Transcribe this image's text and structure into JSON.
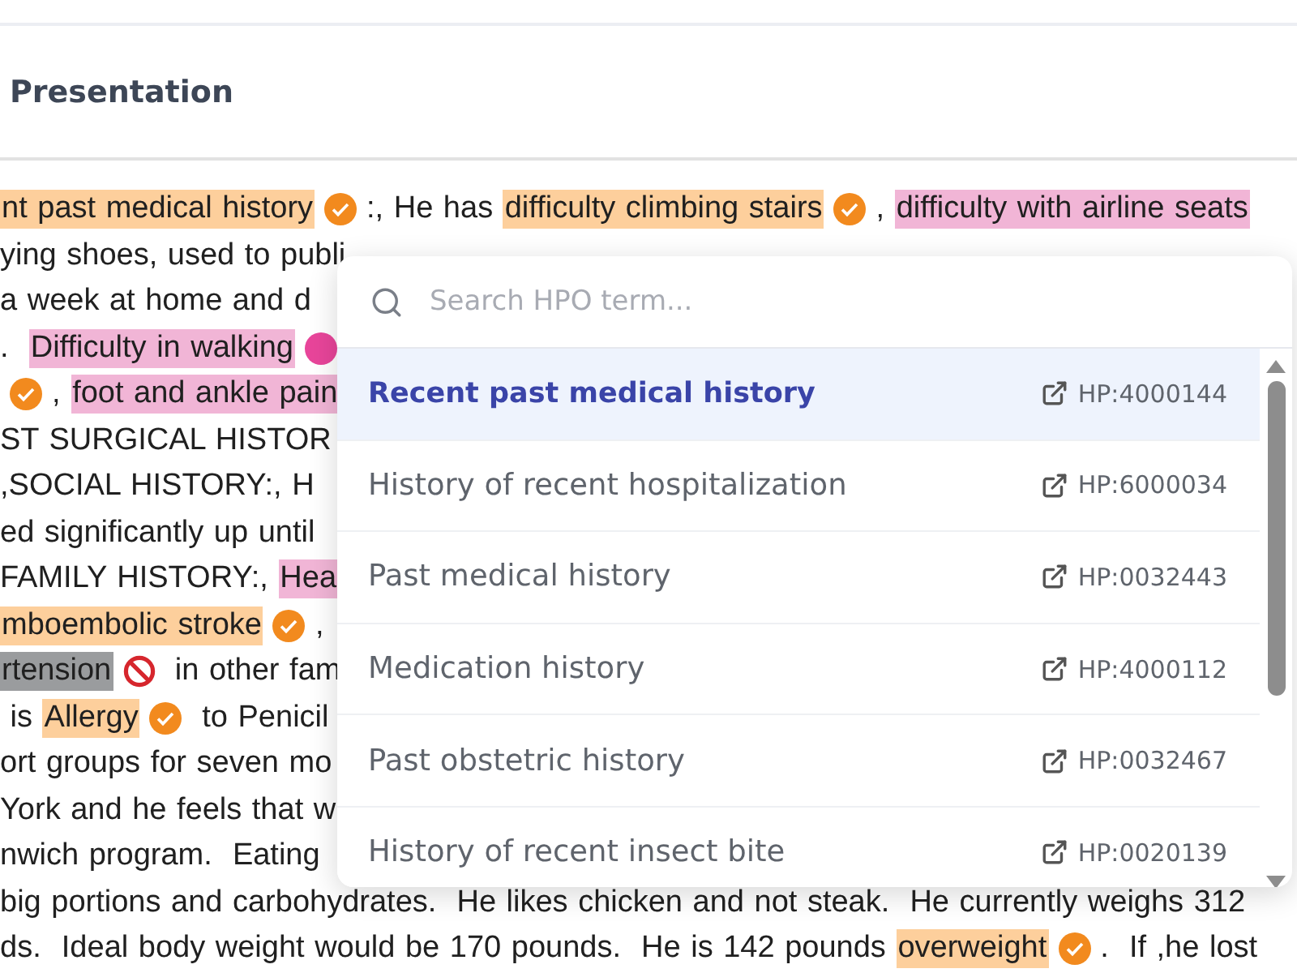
{
  "section": {
    "title": "Presentation"
  },
  "lines": [
    [
      {
        "kind": "term",
        "text": "nt past medical history",
        "color": "#fdcf9c"
      },
      {
        "kind": "check"
      },
      {
        "kind": "text",
        "text": ":, He has "
      },
      {
        "kind": "term",
        "text": "difficulty climbing stairs",
        "color": "#fdcf9c"
      },
      {
        "kind": "check"
      },
      {
        "kind": "text",
        "text": ", "
      },
      {
        "kind": "term",
        "text": "difficulty with airline seats",
        "color": "#f1b5d6"
      }
    ],
    [
      {
        "kind": "text",
        "text": "ying shoes, used to publi"
      }
    ],
    [
      {
        "kind": "text",
        "text": "a week at home and d"
      }
    ],
    [
      {
        "kind": "text",
        "text": ".  "
      },
      {
        "kind": "term",
        "text": "Difficulty in walking",
        "color": "#f1b5d6"
      },
      {
        "kind": "dot",
        "color": "#e8459a"
      }
    ],
    [
      {
        "kind": "check"
      },
      {
        "kind": "text",
        "text": ", "
      },
      {
        "kind": "term",
        "text": "foot and ankle pain",
        "color": "#f1b5d6"
      }
    ],
    [
      {
        "kind": "text",
        "text": "ST SURGICAL HISTOR"
      }
    ],
    [
      {
        "kind": "text",
        "text": ",SOCIAL HISTORY:, H"
      }
    ],
    [
      {
        "kind": "text",
        "text": "ed significantly up until"
      }
    ],
    [
      {
        "kind": "text",
        "text": "FAMILY HISTORY:, "
      },
      {
        "kind": "term",
        "text": "Hea",
        "color": "#f1b5d6"
      }
    ],
    [
      {
        "kind": "term",
        "text": "mboembolic stroke",
        "color": "#fdcf9c"
      },
      {
        "kind": "check"
      },
      {
        "kind": "text",
        "text": ","
      }
    ],
    [
      {
        "kind": "term",
        "text": "rtension",
        "color": "#9a9c9e"
      },
      {
        "kind": "ban"
      },
      {
        "kind": "text",
        "text": " in other fam"
      }
    ],
    [
      {
        "kind": "text",
        "text": " is "
      },
      {
        "kind": "term",
        "text": "Allergy",
        "color": "#fdcf9c"
      },
      {
        "kind": "check"
      },
      {
        "kind": "text",
        "text": " to Penicil"
      }
    ],
    [
      {
        "kind": "text",
        "text": "ort groups for seven mo"
      }
    ],
    [
      {
        "kind": "text",
        "text": "York and he feels that w"
      }
    ],
    [
      {
        "kind": "text",
        "text": "nwich program.  Eating"
      }
    ],
    [
      {
        "kind": "text",
        "text": "big portions and carbohydrates.  He likes chicken and not steak.  He currently weighs 312"
      }
    ],
    [
      {
        "kind": "text",
        "text": "ds.  Ideal body weight would be 170 pounds.  He is 142 pounds "
      },
      {
        "kind": "term",
        "text": "overweight",
        "color": "#fdcf9c"
      },
      {
        "kind": "check"
      },
      {
        "kind": "text",
        "text": ".  If ,he lost"
      }
    ]
  ],
  "popup": {
    "search": {
      "placeholder": "Search HPO term..."
    },
    "items": [
      {
        "label": "Recent past medical history",
        "code": "HP:4000144",
        "selected": true
      },
      {
        "label": "History of recent hospitalization",
        "code": "HP:6000034",
        "selected": false
      },
      {
        "label": "Past medical history",
        "code": "HP:0032443",
        "selected": false
      },
      {
        "label": "Medication history",
        "code": "HP:4000112",
        "selected": false
      },
      {
        "label": "Past obstetric history",
        "code": "HP:0032467",
        "selected": false
      },
      {
        "label": "History of recent insect bite",
        "code": "HP:0020139",
        "selected": false
      }
    ]
  }
}
